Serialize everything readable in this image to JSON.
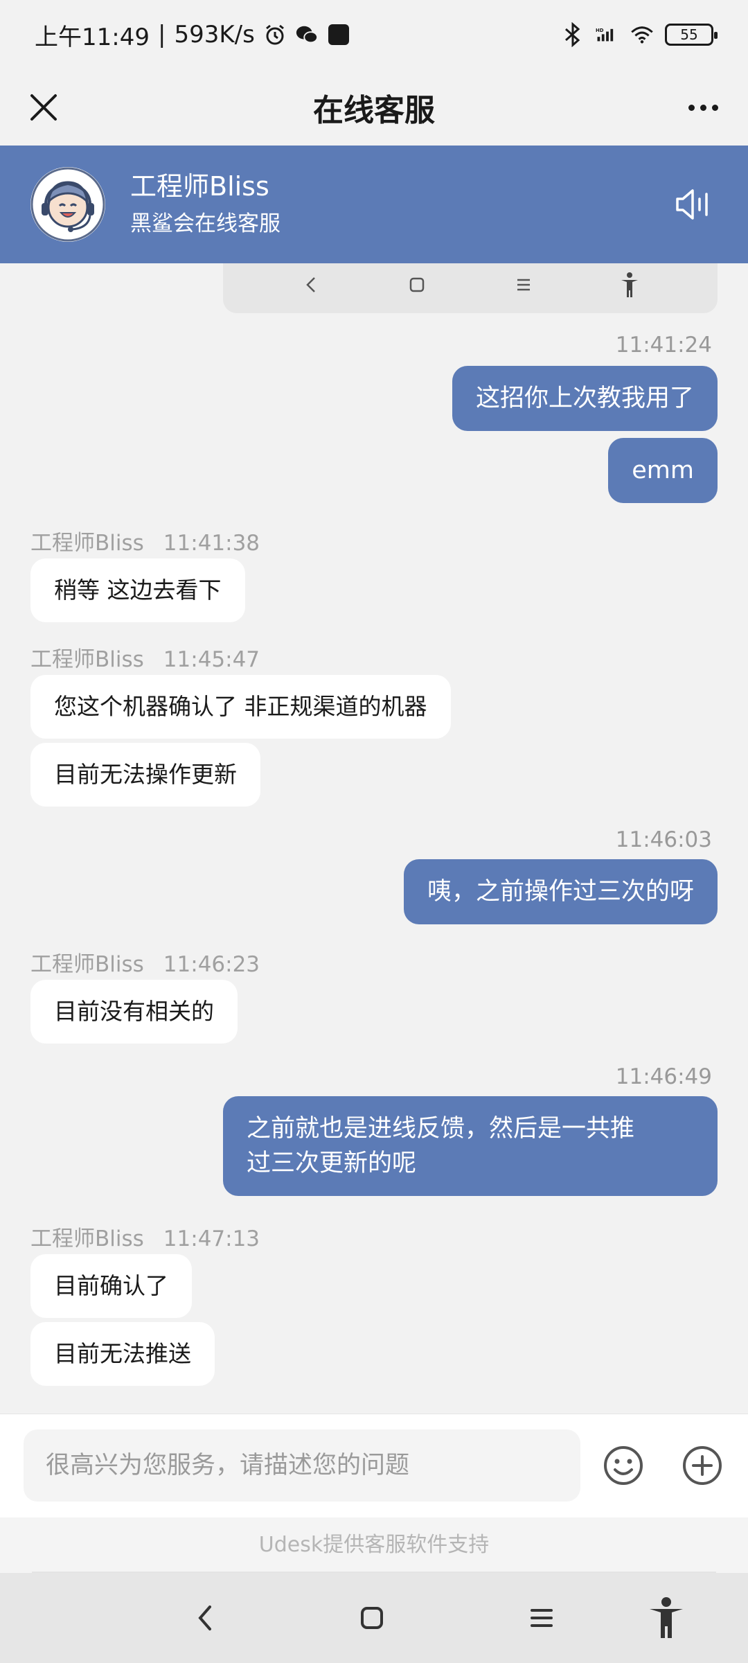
{
  "status_bar": {
    "time": "上午11:49",
    "speed": "593K/s",
    "battery": "55"
  },
  "title_bar": {
    "title": "在线客服"
  },
  "agent": {
    "name": "工程师Bliss",
    "subtitle": "黑鲨会在线客服"
  },
  "messages": {
    "t1": "11:41:24",
    "m1": "这招你上次教我用了",
    "m2": "emm",
    "a1_name": "工程师Bliss",
    "a1_time": "11:41:38",
    "m3": "稍等 这边去看下",
    "a2_name": "工程师Bliss",
    "a2_time": "11:45:47",
    "m4": "您这个机器确认了 非正规渠道的机器",
    "m5": "目前无法操作更新",
    "t2": "11:46:03",
    "m6": "咦，之前操作过三次的呀",
    "a3_name": "工程师Bliss",
    "a3_time": "11:46:23",
    "m7": "目前没有相关的",
    "t3": "11:46:49",
    "m8_line1": "之前就也是进线反馈，然后是一共推",
    "m8_line2": "过三次更新的呢",
    "a4_name": "工程师Bliss",
    "a4_time": "11:47:13",
    "m9": "目前确认了",
    "m10": "目前无法推送"
  },
  "input": {
    "placeholder": "很高兴为您服务，请描述您的问题"
  },
  "footer": {
    "powered_by": "Udesk提供客服软件支持"
  },
  "colors": {
    "accent": "#5c7bb6",
    "background": "#f2f2f2"
  }
}
